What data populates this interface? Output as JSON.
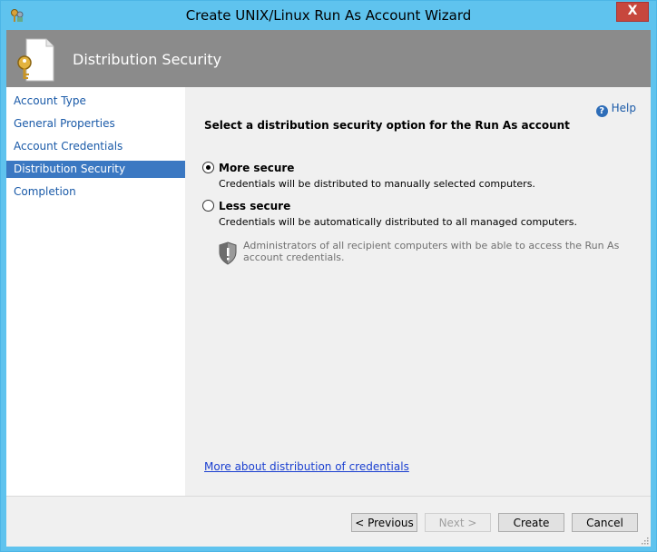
{
  "window": {
    "title": "Create UNIX/Linux Run As Account Wizard",
    "close_label": "X"
  },
  "header": {
    "title": "Distribution Security"
  },
  "nav": {
    "items": [
      {
        "label": "Account Type",
        "selected": false
      },
      {
        "label": "General Properties",
        "selected": false
      },
      {
        "label": "Account Credentials",
        "selected": false
      },
      {
        "label": "Distribution Security",
        "selected": true
      },
      {
        "label": "Completion",
        "selected": false
      }
    ]
  },
  "content": {
    "help_label": "Help",
    "prompt": "Select a distribution security option for the Run As account",
    "options": [
      {
        "label": "More secure",
        "description": "Credentials will be distributed to manually selected computers.",
        "checked": true
      },
      {
        "label": "Less secure",
        "description": "Credentials will be automatically distributed to all managed computers.",
        "checked": false
      }
    ],
    "info_text": "Administrators of all recipient computers with be able to access the Run As account credentials.",
    "more_link": "More about distribution of credentials"
  },
  "footer": {
    "previous_label": "< Previous",
    "next_label": "Next >",
    "create_label": "Create",
    "cancel_label": "Cancel"
  },
  "colors": {
    "titlebar": "#5fc3ee",
    "header": "#8b8b8b",
    "selected_nav": "#3b78c2",
    "link": "#1a5aa8"
  },
  "icons": [
    "app-icon",
    "key-document-icon",
    "help-icon",
    "shield-icon",
    "close-icon"
  ]
}
